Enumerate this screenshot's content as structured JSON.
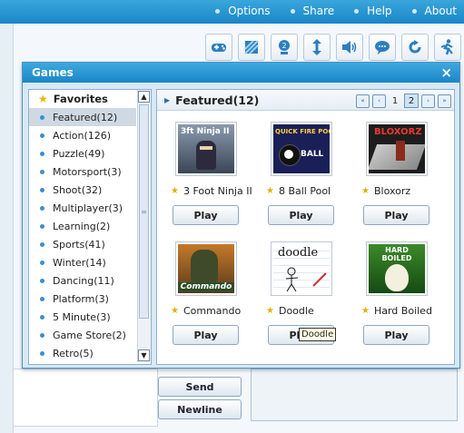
{
  "topmenu": [
    "Options",
    "Share",
    "Help",
    "About"
  ],
  "toolbar_icons": [
    "gamepad-icon",
    "picture-icon",
    "coin-icon",
    "resize-icon",
    "speaker-icon",
    "chat-bubble-icon",
    "redo-icon",
    "run-icon"
  ],
  "bottom": {
    "send_label": "Send",
    "newline_label": "Newline"
  },
  "dialog": {
    "title": "Games",
    "close_label": "×",
    "sidebar": {
      "header": "Favorites",
      "items": [
        "Featured(12)",
        "Action(126)",
        "Puzzle(49)",
        "Motorsport(3)",
        "Shoot(32)",
        "Multiplayer(3)",
        "Learning(2)",
        "Sports(41)",
        "Winter(14)",
        "Dancing(11)",
        "Platform(3)",
        "5 Minute(3)",
        "Game Store(2)",
        "Retro(5)"
      ],
      "selected": "Featured(12)"
    },
    "content": {
      "title": "Featured(12)",
      "pages": [
        "1",
        "2"
      ],
      "current_page": "1",
      "play_label": "Play",
      "games": [
        {
          "name": "3 Foot Ninja II",
          "thumb_text": "3ft Ninja II"
        },
        {
          "name": "8 Ball Pool",
          "thumb_text": "QUICK FIRE POOL"
        },
        {
          "name": "Bloxorz",
          "thumb_text": "BLOXORZ"
        },
        {
          "name": "Commando",
          "thumb_text": "Commando"
        },
        {
          "name": "Doodle",
          "thumb_text": "doodle"
        },
        {
          "name": "Hard Boiled",
          "thumb_text": "HARD BOILED"
        }
      ],
      "tooltip": "Doodle"
    }
  }
}
